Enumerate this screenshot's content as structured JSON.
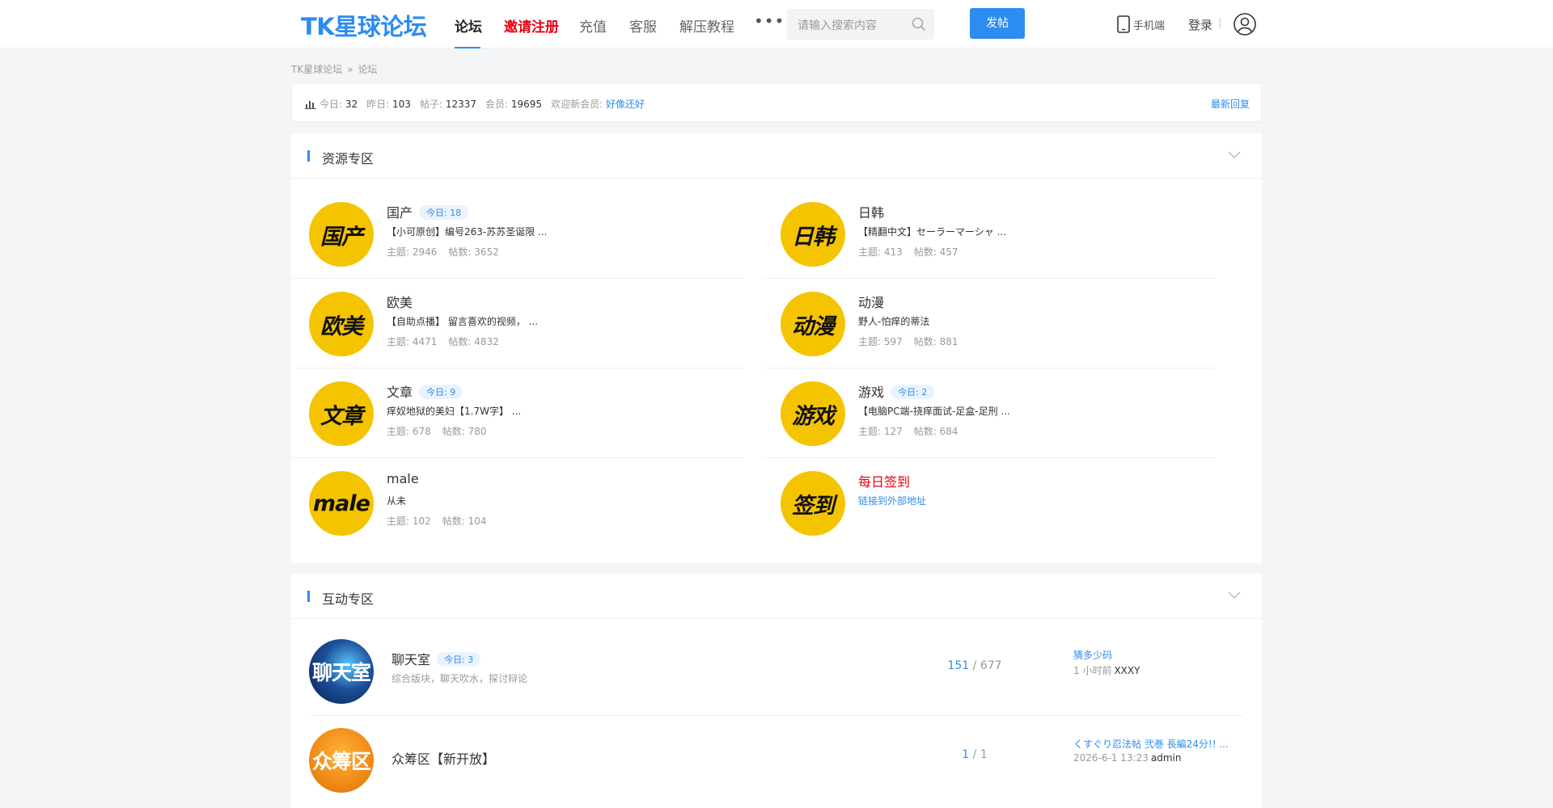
{
  "header": {
    "logo": "TK星球论坛",
    "nav": [
      "论坛",
      "邀请注册",
      "充值",
      "客服",
      "解压教程"
    ],
    "more": "•••",
    "search_placeholder": "请输入搜索内容",
    "post_button": "发帖",
    "mobile": "手机端",
    "login": "登录",
    "separator": "|",
    "accent_color": "#2d8cf0",
    "highlight_color": "#e60012"
  },
  "breadcrumb": [
    "TK星球论坛",
    "»",
    "论坛"
  ],
  "stats": {
    "today_label": "今日:",
    "today": "32",
    "yesterday_label": "昨日:",
    "yesterday": "103",
    "posts_label": "帖子:",
    "posts": "12337",
    "members_label": "会员:",
    "members": "19695",
    "welcome_label": "欢迎新会员:",
    "new_member": "好像还好",
    "latest_reply": "最新回复"
  },
  "resource_section": {
    "title": "资源专区",
    "forums": [
      {
        "icon_text": "国产",
        "name": "国产",
        "today": "今日: 18",
        "last": "【小可原创】编号263-苏苏圣诞限 ...",
        "topics_label": "主题:",
        "topics": "2946",
        "posts_label": "帖数:",
        "posts": "3652"
      },
      {
        "icon_text": "日韩",
        "name": "日韩",
        "today": "",
        "last": "【精翻中文】セーラーマーシャ ...",
        "topics_label": "主题:",
        "topics": "413",
        "posts_label": "帖数:",
        "posts": "457"
      },
      {
        "icon_text": "欧美",
        "name": "欧美",
        "today": "",
        "last": "【自助点播】 留言喜欢的视频， ...",
        "topics_label": "主题:",
        "topics": "4471",
        "posts_label": "帖数:",
        "posts": "4832"
      },
      {
        "icon_text": "动漫",
        "name": "动漫",
        "today": "",
        "last": "野人-怕痒的蒂法",
        "topics_label": "主题:",
        "topics": "597",
        "posts_label": "帖数:",
        "posts": "881"
      },
      {
        "icon_text": "文章",
        "name": "文章",
        "today": "今日: 9",
        "last": "痒奴地狱的美妇【1.7W字】 ...",
        "topics_label": "主题:",
        "topics": "678",
        "posts_label": "帖数:",
        "posts": "780"
      },
      {
        "icon_text": "游戏",
        "name": "游戏",
        "today": "今日: 2",
        "last": "【电脑PC端-挠痒面试-足盒-足刑 ...",
        "topics_label": "主题:",
        "topics": "127",
        "posts_label": "帖数:",
        "posts": "684"
      },
      {
        "icon_text": "male",
        "name": "male",
        "today": "",
        "last": "从未",
        "topics_label": "主题:",
        "topics": "102",
        "posts_label": "帖数:",
        "posts": "104"
      },
      {
        "icon_text": "签到",
        "name": "每日签到",
        "today": "",
        "last": "链接到外部地址",
        "topics_label": "",
        "topics": "",
        "posts_label": "",
        "posts": ""
      }
    ]
  },
  "interactive_section": {
    "title": "互动专区",
    "forums": [
      {
        "icon_text": "聊天室",
        "icon_color": "#1b4f9a",
        "name": "聊天室",
        "today": "今日: 3",
        "desc": "综合版块，聊天吹水，探讨辩论",
        "topics": "151",
        "slash": "/",
        "posts": "677",
        "last": "猜多少码",
        "time": "1 小时前",
        "user": "XXXY"
      },
      {
        "icon_text": "众筹区",
        "icon_color": "#ef8a16",
        "name": "众筹区【新开放】",
        "today": "",
        "desc": "",
        "topics": "1",
        "slash": "/",
        "posts": "1",
        "last": "くすぐり忍法帖 弐巻 長編24分!! ...",
        "time": "2026-6-1 13:23",
        "user": "admin"
      }
    ]
  }
}
